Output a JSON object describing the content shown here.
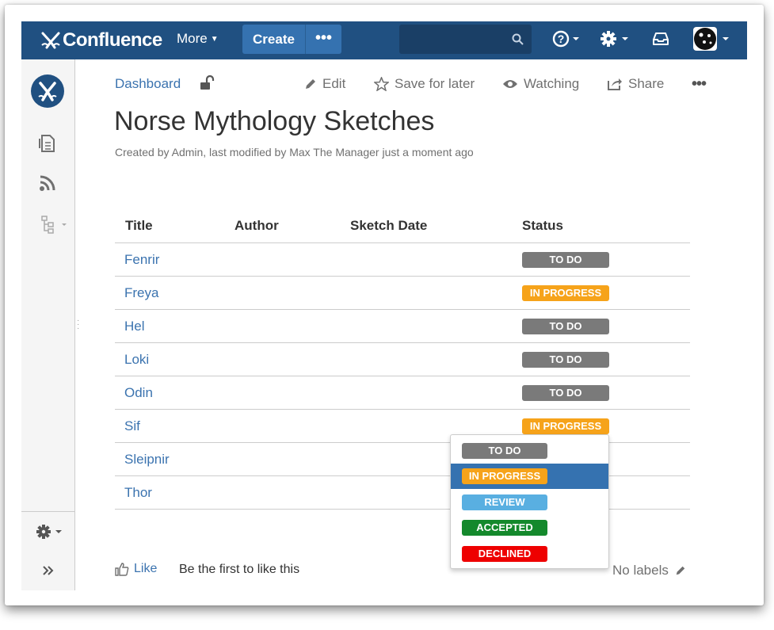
{
  "header": {
    "app_name": "Confluence",
    "more_label": "More",
    "create_label": "Create",
    "create_more_label": "•••"
  },
  "breadcrumb": {
    "dashboard": "Dashboard"
  },
  "actions": {
    "edit": "Edit",
    "save_for_later": "Save for later",
    "watching": "Watching",
    "share": "Share",
    "more": "•••"
  },
  "page": {
    "title": "Norse Mythology Sketches",
    "meta": "Created by Admin, last modified by Max The Manager just a moment ago"
  },
  "table": {
    "headers": [
      "Title",
      "Author",
      "Sketch Date",
      "Status"
    ],
    "rows": [
      {
        "title": "Fenrir",
        "status": "TO DO"
      },
      {
        "title": "Freya",
        "status": "IN PROGRESS"
      },
      {
        "title": "Hel",
        "status": "TO DO"
      },
      {
        "title": "Loki",
        "status": "TO DO"
      },
      {
        "title": "Odin",
        "status": "TO DO"
      },
      {
        "title": "Sif",
        "status": "IN PROGRESS"
      },
      {
        "title": "Sleipnir",
        "status": ""
      },
      {
        "title": "Thor",
        "status": ""
      }
    ]
  },
  "status_dropdown": {
    "options": [
      {
        "label": "TO DO",
        "color": "#7a7a7a"
      },
      {
        "label": "IN PROGRESS",
        "color": "#f6a31a"
      },
      {
        "label": "REVIEW",
        "color": "#59afe1"
      },
      {
        "label": "ACCEPTED",
        "color": "#14892c"
      },
      {
        "label": "DECLINED",
        "color": "#ee0000"
      }
    ],
    "selected_index": 1
  },
  "footer": {
    "like": "Like",
    "like_first": "Be the first to like this",
    "no_labels": "No labels"
  },
  "colors": {
    "header_bg": "#205081",
    "link": "#3b73af",
    "todo": "#7a7a7a",
    "in_progress": "#f6a31a"
  }
}
